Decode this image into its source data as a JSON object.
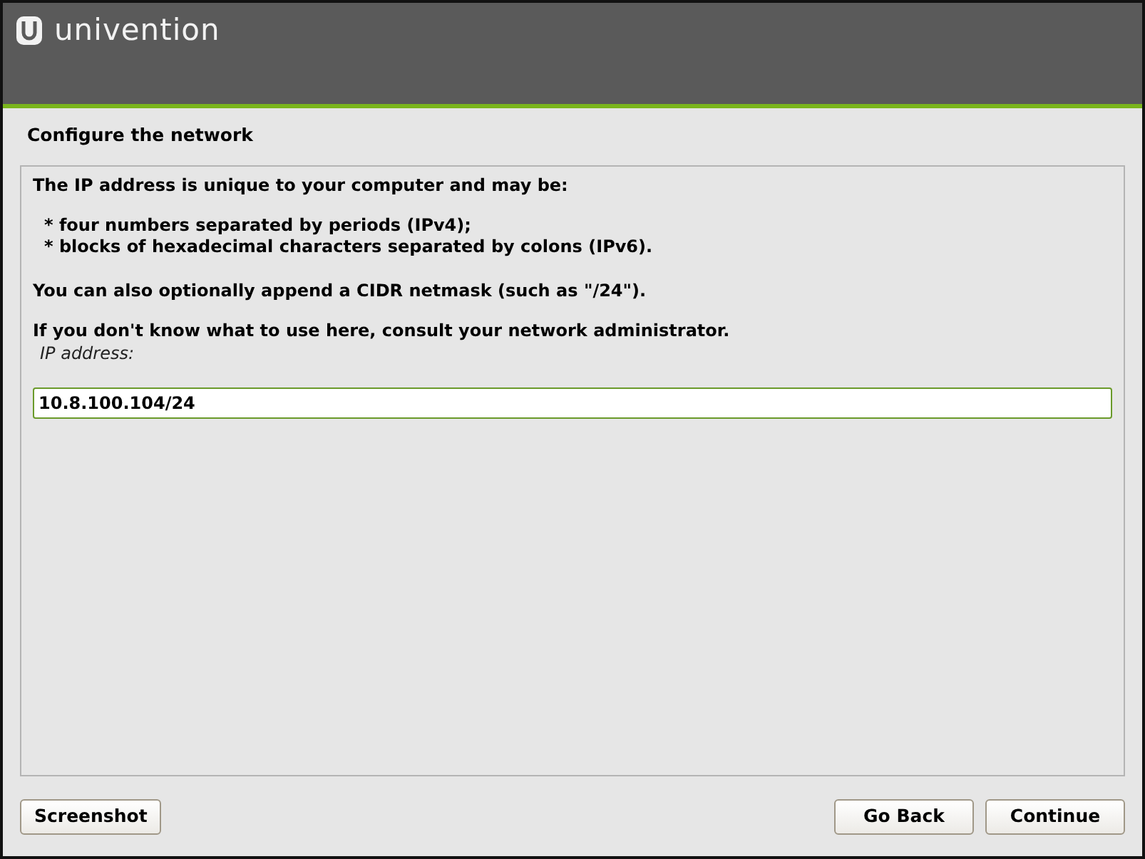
{
  "header": {
    "logo_text": "univention"
  },
  "title": "Configure the network",
  "paragraphs": [
    {
      "kind": "text",
      "text": "The IP address is unique to your computer and may be:"
    },
    {
      "kind": "bullets",
      "items": [
        "* four numbers separated by periods (IPv4);",
        "* blocks of hexadecimal characters separated by colons (IPv6)."
      ]
    },
    {
      "kind": "text",
      "text": "You can also optionally append a CIDR netmask (such as \"/24\")."
    },
    {
      "kind": "text",
      "text": "If you don't know what to use here, consult your network administrator."
    }
  ],
  "field": {
    "label": "IP address:",
    "value": "10.8.100.104/24",
    "focused": true
  },
  "buttons_left": [
    "Screenshot"
  ],
  "buttons_right": [
    "Go Back",
    "Continue"
  ]
}
